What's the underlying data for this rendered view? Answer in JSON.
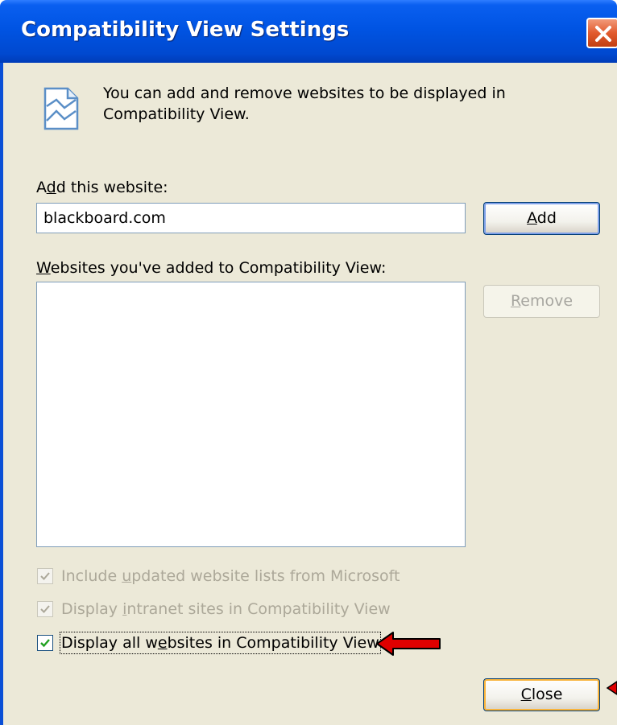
{
  "window": {
    "title": "Compatibility View Settings"
  },
  "info": {
    "icon": "compatibility-view-icon",
    "description": "You can add and remove websites to be displayed in Compatibility View."
  },
  "add_site": {
    "label_pre": "A",
    "label_accel": "d",
    "label_post": "d this website:",
    "input_value": "blackboard.com",
    "button_accel": "A",
    "button_rest": "dd"
  },
  "site_list": {
    "label_accel": "W",
    "label_post": "ebsites you've added to Compatibility View:",
    "items": [],
    "remove_accel": "R",
    "remove_rest": "emove"
  },
  "options": {
    "include_updated": {
      "pre": "Include ",
      "accel": "u",
      "post": "pdated website lists from Microsoft",
      "checked": true,
      "enabled": false
    },
    "intranet": {
      "pre": "Display ",
      "accel": "i",
      "post": "ntranet sites in Compatibility View",
      "checked": true,
      "enabled": false
    },
    "display_all": {
      "pre": "Display all w",
      "accel": "e",
      "post": "bsites in Compatibility View",
      "checked": true,
      "enabled": true
    }
  },
  "footer": {
    "close_accel": "C",
    "close_rest": "lose"
  },
  "colors": {
    "titlebar": "#0054e3",
    "dialog_bg": "#ece9d8",
    "annotation_arrow": "#e00000"
  }
}
